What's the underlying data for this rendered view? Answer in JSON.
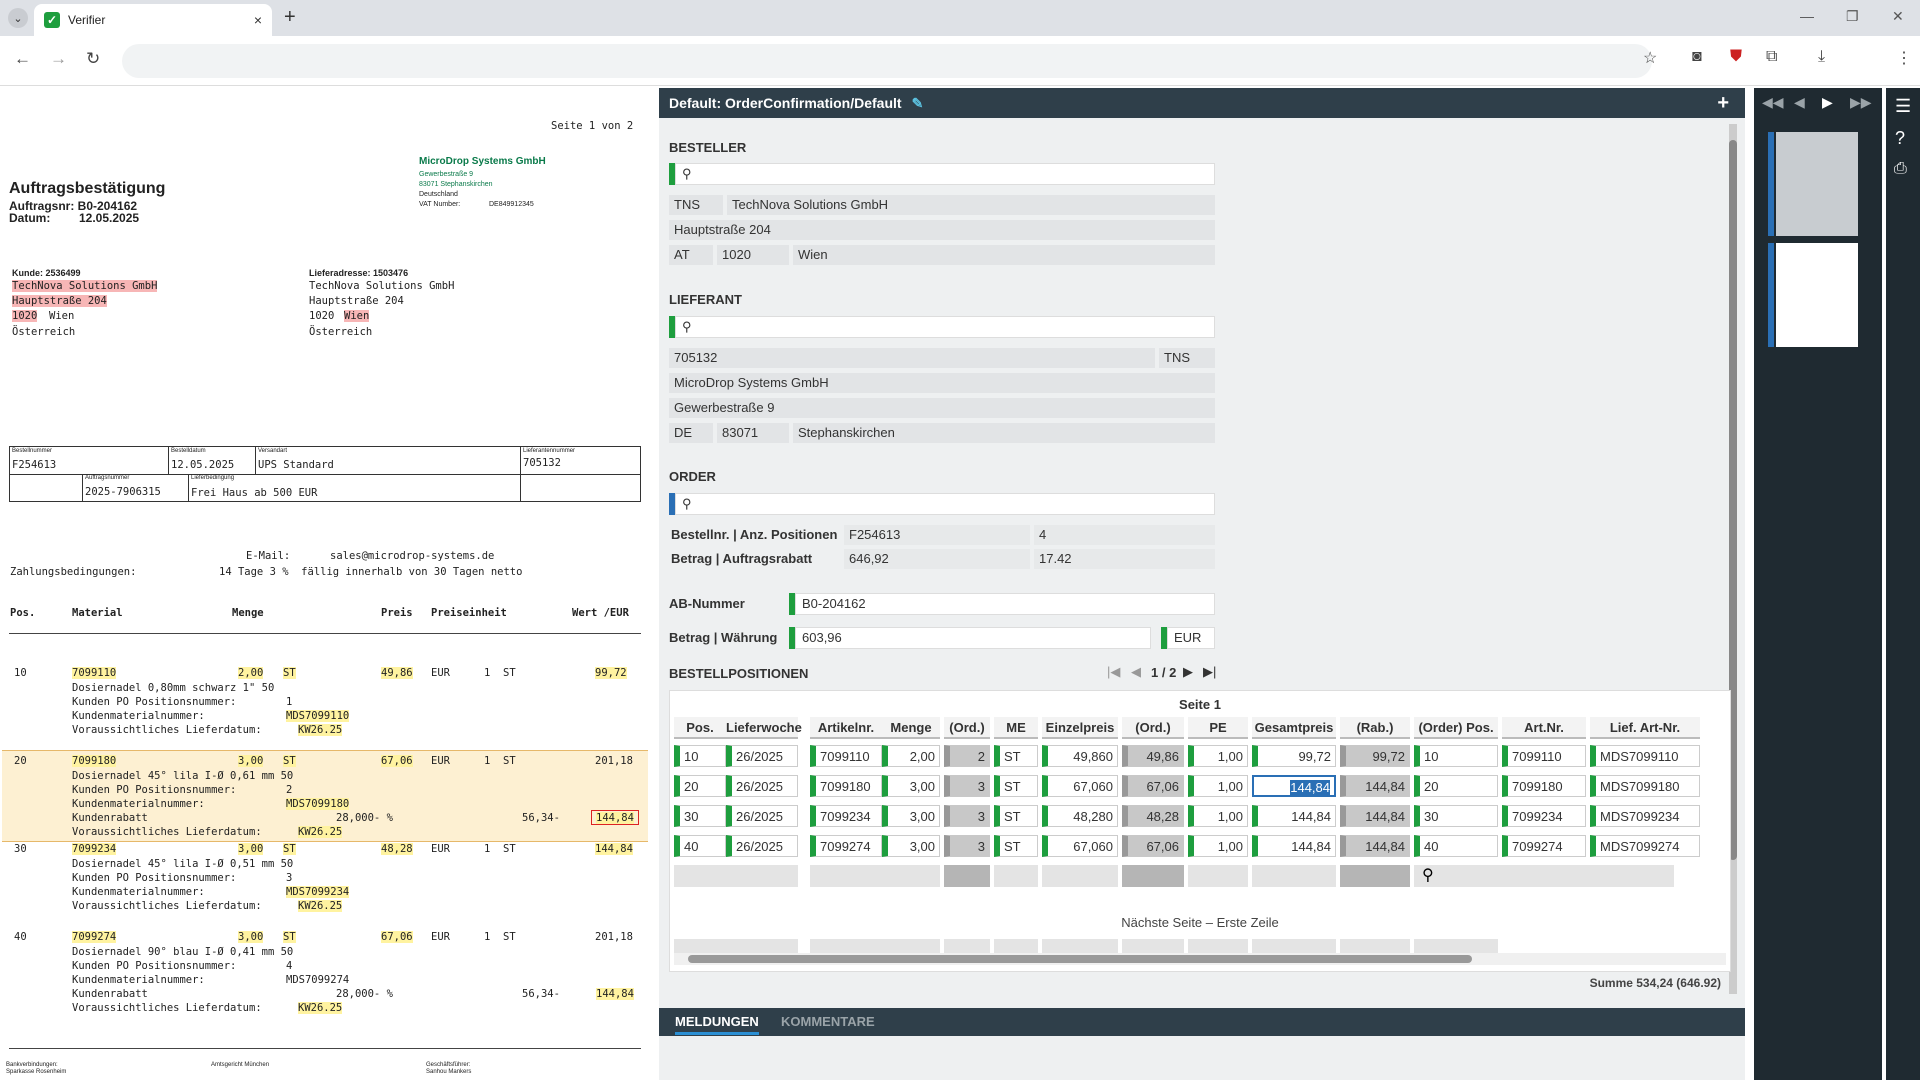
{
  "browser": {
    "tab_title": "Verifier",
    "close": "×",
    "new_tab": "+",
    "tab_menu": "⌄"
  },
  "doc": {
    "page": "Seite 1 von 2",
    "supplier_name": "MicroDrop Systems GmbH",
    "supplier_street": "Gewerbestraße 9",
    "supplier_city": "83071 Stephanskirchen",
    "supplier_country": "Deutschland",
    "vat_label": "VAT Number:",
    "vat_value": "DE849912345",
    "title": "Auftragsbestätigung",
    "order_nr": "Auftragsnr: B0-204162",
    "date_label": "Datum:",
    "date": "12.05.2025",
    "customer_label": "Kunde: 2536499",
    "cust_name": "TechNova Solutions GmbH",
    "cust_street": "Hauptstraße 204",
    "cust_zip": "1020",
    "cust_city": "Wien",
    "cust_country": "Österreich",
    "delivery_label": "Lieferadresse: 1503476",
    "del_name": "TechNova Solutions GmbH",
    "del_street": "Hauptstraße 204",
    "del_zip": "1020",
    "del_city": "Wien",
    "del_country": "Österreich",
    "box": {
      "h1": "Bestellnummer",
      "v1": "F254613",
      "h2": "Bestelldatum",
      "v2": "12.05.2025",
      "h3": "Versandart",
      "v3": "UPS Standard",
      "h4": "Lieferantennummer",
      "v4": "705132",
      "h5": "Auftragsnummer",
      "v5": "2025-7906315",
      "h6": "Lieferbedingung",
      "v6": "Frei Haus ab 500 EUR"
    },
    "email_label": "E-Mail:",
    "email": "sales@microdrop-systems.de",
    "payment_label": "Zahlungsbedingungen:",
    "payment": "14 Tage 3 %  fällig innerhalb von 30 Tagen netto",
    "col_pos": "Pos.",
    "col_mat": "Material",
    "col_qty": "Menge",
    "col_price": "Preis",
    "col_unit": "Preiseinheit",
    "col_val": "Wert /EUR",
    "items": [
      {
        "pos": "10",
        "mat": "7099110",
        "qty": "2,00",
        "u": "ST",
        "price": "49,86",
        "cur": "EUR",
        "pe": "1",
        "peu": "ST",
        "val": "99,72",
        "l1": "Dosiernadel 0,80mm schwarz 1\" 50",
        "l2": "Kunden PO Positionsnummer:",
        "l2v": "1",
        "l3": "Kundenmaterialnummer:",
        "l3v": "MDS7099110",
        "l4": "Voraussichtliches Lieferdatum:",
        "l4v": "KW26.25"
      },
      {
        "pos": "20",
        "mat": "7099180",
        "qty": "3,00",
        "u": "ST",
        "price": "67,06",
        "cur": "EUR",
        "pe": "1",
        "peu": "ST",
        "val": "201,18",
        "l1": "Dosiernadel 45° lila I-Ø 0,61 mm 50",
        "l2": "Kunden PO Positionsnummer:",
        "l2v": "2",
        "l3": "Kundenmaterialnummer:",
        "l3v": "MDS7099180",
        "rab": "Kundenrabatt",
        "rabp": "28,000- %",
        "rabv": "56,34-",
        "rabt": "144,84",
        "l4": "Voraussichtliches Lieferdatum:",
        "l4v": "KW26.25"
      },
      {
        "pos": "30",
        "mat": "7099234",
        "qty": "3,00",
        "u": "ST",
        "price": "48,28",
        "cur": "EUR",
        "pe": "1",
        "peu": "ST",
        "val": "144,84",
        "l1": "Dosiernadel 45° lila I-Ø 0,51 mm 50",
        "l2": "Kunden PO Positionsnummer:",
        "l2v": "3",
        "l3": "Kundenmaterialnummer:",
        "l3v": "MDS7099234",
        "l4": "Voraussichtliches Lieferdatum:",
        "l4v": "KW26.25"
      },
      {
        "pos": "40",
        "mat": "7099274",
        "qty": "3,00",
        "u": "ST",
        "price": "67,06",
        "cur": "EUR",
        "pe": "1",
        "peu": "ST",
        "val": "201,18",
        "l1": "Dosiernadel 90° blau I-Ø 0,41 mm 50",
        "l2": "Kunden PO Positionsnummer:",
        "l2v": "4",
        "l3": "Kundenmaterialnummer:",
        "l3v": "MDS7099274",
        "rab": "Kundenrabatt",
        "rabp": "28,000- %",
        "rabv": "56,34-",
        "rabt": "144,84",
        "l4": "Voraussichtliches Lieferdatum:",
        "l4v": "KW26.25"
      }
    ],
    "footer1": "Bankverbindungen:",
    "footer1b": "Sparkasse Rosenheim",
    "footer2": "Amtsgericht München",
    "footer3": "Geschäftsführer:",
    "footer3b": "Sanhou Mankers"
  },
  "panel": {
    "title": "Default: OrderConfirmation/Default",
    "add": "+",
    "besteller": "BESTELLER",
    "b_code": "TNS",
    "b_name": "TechNova Solutions GmbH",
    "b_street": "Hauptstraße 204",
    "b_country": "AT",
    "b_zip": "1020",
    "b_city": "Wien",
    "lieferant": "LIEFERANT",
    "l_nr": "705132",
    "l_code": "TNS",
    "l_name": "MicroDrop Systems GmbH",
    "l_street": "Gewerbestraße 9",
    "l_country": "DE",
    "l_zip": "83071",
    "l_city": "Stephanskirchen",
    "order": "ORDER",
    "o_lbl1": "Bestellnr. | Anz. Positionen",
    "o_v1": "F254613",
    "o_v1b": "4",
    "o_lbl2": "Betrag | Auftragsrabatt",
    "o_v2": "646,92",
    "o_v2b": "17.42",
    "ab_lbl": "AB-Nummer",
    "ab_val": "B0-204162",
    "bw_lbl": "Betrag | Währung",
    "bw_val": "603,96",
    "bw_cur": "EUR",
    "pos_lbl": "BESTELLPOSITIONEN",
    "pager": "1 / 2",
    "page_lbl": "Seite 1",
    "headers": [
      "Pos.",
      "Lieferwoche",
      "Artikelnr.",
      "Menge",
      "(Ord.)",
      "ME",
      "Einzelpreis",
      "(Ord.)",
      "PE",
      "Gesamtpreis",
      "(Rab.)",
      "(Order) Pos.",
      "Art.Nr.",
      "Lief. Art-Nr."
    ],
    "rows": [
      [
        "10",
        "26/2025",
        "7099110",
        "2,00",
        "2",
        "ST",
        "49,860",
        "49,86",
        "1,00",
        "99,72",
        "99,72",
        "10",
        "7099110",
        "MDS7099110"
      ],
      [
        "20",
        "26/2025",
        "7099180",
        "3,00",
        "3",
        "ST",
        "67,060",
        "67,06",
        "1,00",
        "144,84",
        "144,84",
        "20",
        "7099180",
        "MDS7099180"
      ],
      [
        "30",
        "26/2025",
        "7099234",
        "3,00",
        "3",
        "ST",
        "48,280",
        "48,28",
        "1,00",
        "144,84",
        "144,84",
        "30",
        "7099234",
        "MDS7099234"
      ],
      [
        "40",
        "26/2025",
        "7099274",
        "3,00",
        "3",
        "ST",
        "67,060",
        "67,06",
        "1,00",
        "144,84",
        "144,84",
        "40",
        "7099274",
        "MDS7099274"
      ]
    ],
    "next_page": "Nächste Seite – Erste Zeile",
    "sum": "Summe 534,24 (646.92)",
    "tab1": "MELDUNGEN",
    "tab2": "KOMMENTARE"
  }
}
